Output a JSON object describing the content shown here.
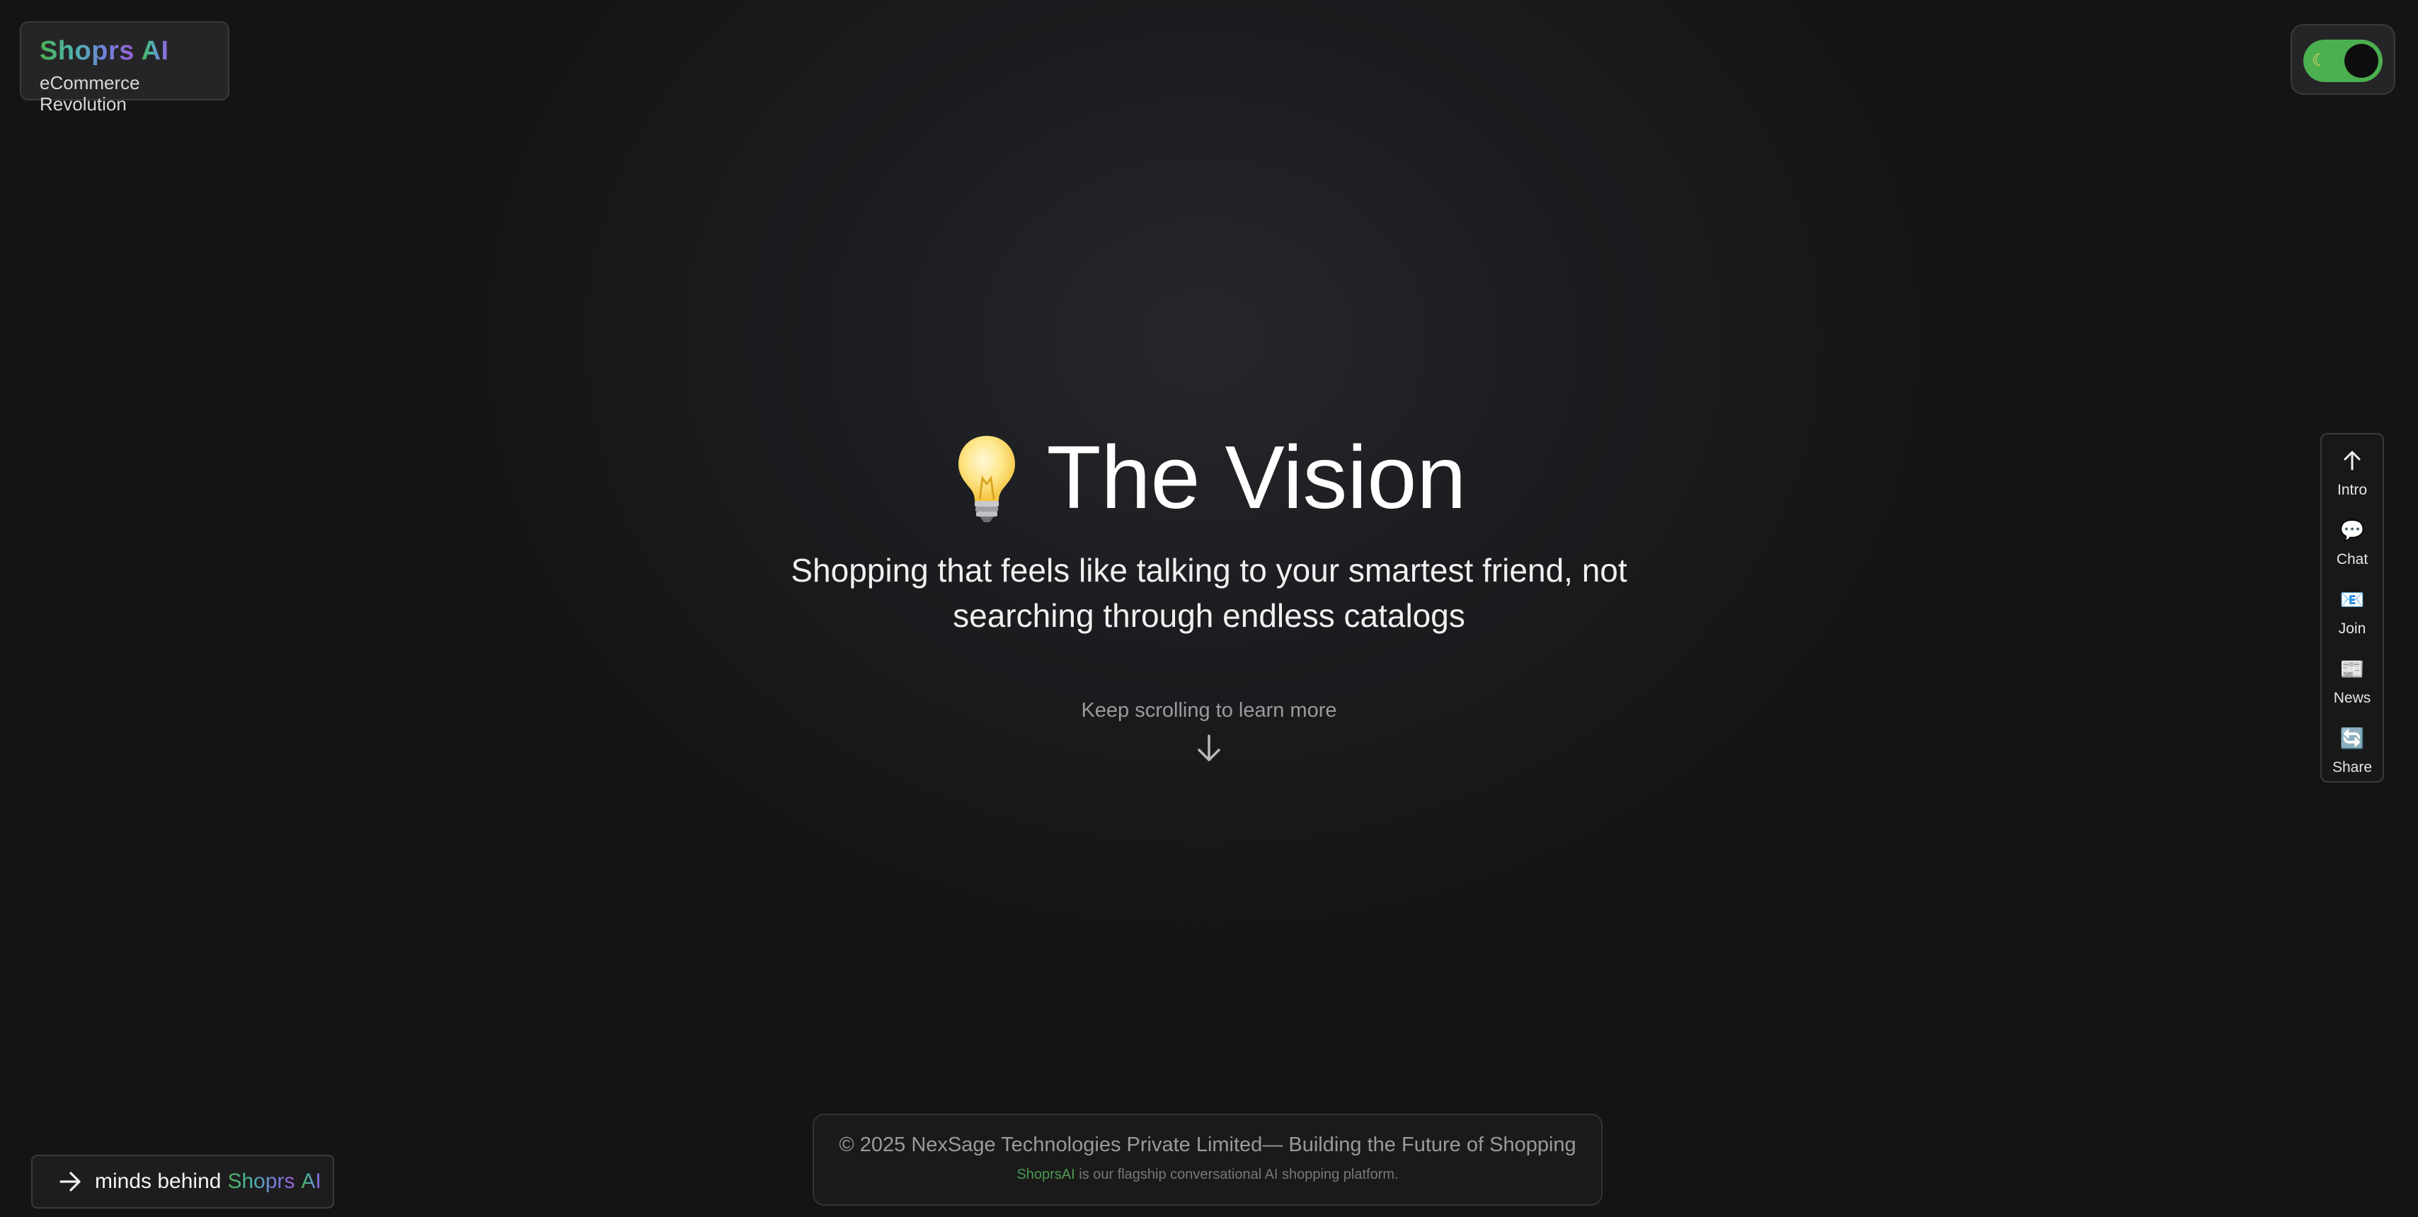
{
  "brand": {
    "title_prefix": "Shoprs",
    "title_suffix": "AI",
    "tagline": "eCommerce Revolution"
  },
  "theme_toggle": {
    "icon": "moon-icon",
    "state": "dark"
  },
  "hero": {
    "icon": "lightbulb-icon",
    "title": "The Vision",
    "subtitle": "Shopping that feels like talking to your smartest friend, not searching through endless catalogs",
    "scroll_hint": "Keep scrolling to learn more",
    "scroll_icon": "arrow-down-icon"
  },
  "sidenav": {
    "items": [
      {
        "label": "Intro",
        "icon": "arrow-up-icon",
        "glyph": "↑"
      },
      {
        "label": "Chat",
        "icon": "speech-bubble-icon",
        "glyph": "💬"
      },
      {
        "label": "Join",
        "icon": "envelope-icon",
        "glyph": "📧"
      },
      {
        "label": "News",
        "icon": "newspaper-icon",
        "glyph": "📰"
      },
      {
        "label": "Share",
        "icon": "refresh-icon",
        "glyph": "🔄"
      }
    ]
  },
  "minds_link": {
    "icon": "arrow-right-icon",
    "text": "minds behind",
    "brand_prefix": "Shoprs",
    "brand_suffix": "AI"
  },
  "footer": {
    "copyright": "© 2025 NexSage Technologies Private Limited— Building the Future of Shopping",
    "sub_brand": "ShoprsAI",
    "sub_text": "is our flagship conversational AI shopping platform."
  },
  "colors": {
    "accent_green": "#4caf50",
    "accent_purple": "#9c5fd6",
    "background": "#1c1d20"
  }
}
